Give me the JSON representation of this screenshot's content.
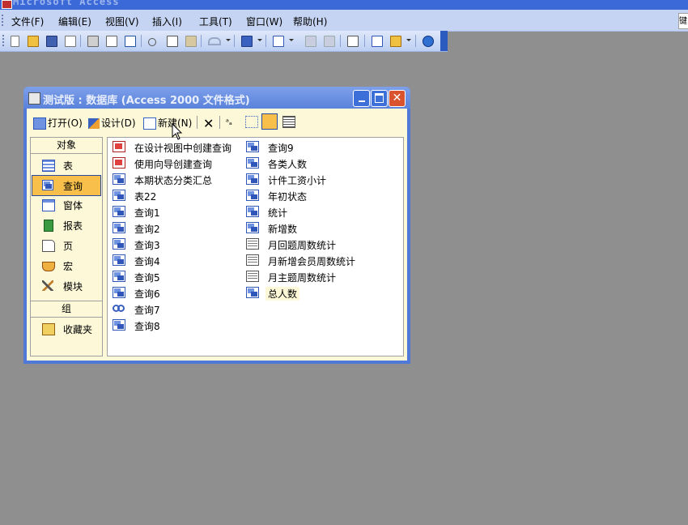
{
  "app": {
    "title": "Microsoft Access"
  },
  "menubar": {
    "items": [
      {
        "label": "文件(F)"
      },
      {
        "label": "编辑(E)"
      },
      {
        "label": "视图(V)"
      },
      {
        "label": "插入(I)"
      },
      {
        "label": "工具(T)"
      },
      {
        "label": "窗口(W)"
      },
      {
        "label": "帮助(H)"
      }
    ],
    "right_cut": "键"
  },
  "toolbar": {
    "icons": [
      "new-icon",
      "open-icon",
      "save-icon",
      "search-file-icon",
      "print-icon",
      "print-preview-icon",
      "spelling-icon",
      "cut-icon",
      "copy-icon",
      "paste-icon",
      "undo-icon",
      "office-links-icon",
      "analyze-icon",
      "code-icon",
      "script-icon",
      "properties-icon",
      "relationships-icon",
      "new-object-icon",
      "help-icon"
    ]
  },
  "db_window": {
    "title": "测试版 : 数据库 (Access 2000 文件格式)",
    "toolbar": {
      "open": "打开(O)",
      "design": "设计(D)",
      "new": "新建(N)"
    },
    "objects_header": "对象",
    "objects": [
      {
        "label": "表",
        "icon": "table-icon"
      },
      {
        "label": "查询",
        "icon": "query-icon",
        "selected": true
      },
      {
        "label": "窗体",
        "icon": "form-icon"
      },
      {
        "label": "报表",
        "icon": "report-icon"
      },
      {
        "label": "页",
        "icon": "page-icon"
      },
      {
        "label": "宏",
        "icon": "macro-icon"
      },
      {
        "label": "模块",
        "icon": "module-icon"
      }
    ],
    "groups_header": "组",
    "groups": [
      {
        "label": "收藏夹",
        "icon": "favorites-icon"
      }
    ],
    "list_col1": [
      {
        "label": "在设计视图中创建查询",
        "icon": "wizard"
      },
      {
        "label": "使用向导创建查询",
        "icon": "wizard"
      },
      {
        "label": "本期状态分类汇总",
        "icon": "query"
      },
      {
        "label": "表22",
        "icon": "query"
      },
      {
        "label": "查询1",
        "icon": "query"
      },
      {
        "label": "查询2",
        "icon": "query"
      },
      {
        "label": "查询3",
        "icon": "query"
      },
      {
        "label": "查询4",
        "icon": "query"
      },
      {
        "label": "查询5",
        "icon": "query"
      },
      {
        "label": "查询6",
        "icon": "query"
      },
      {
        "label": "查询7",
        "icon": "union"
      },
      {
        "label": "查询8",
        "icon": "query"
      }
    ],
    "list_col2": [
      {
        "label": "查询9",
        "icon": "query"
      },
      {
        "label": "各类人数",
        "icon": "query"
      },
      {
        "label": "计件工资小计",
        "icon": "query"
      },
      {
        "label": "年初状态",
        "icon": "query"
      },
      {
        "label": "统计",
        "icon": "query"
      },
      {
        "label": "新增数",
        "icon": "query"
      },
      {
        "label": "月回题周数统计",
        "icon": "crosstab"
      },
      {
        "label": "月新增会员周数统计",
        "icon": "crosstab"
      },
      {
        "label": "月主题周数统计",
        "icon": "crosstab"
      },
      {
        "label": "总人数",
        "icon": "query",
        "highlighted": true
      }
    ]
  }
}
